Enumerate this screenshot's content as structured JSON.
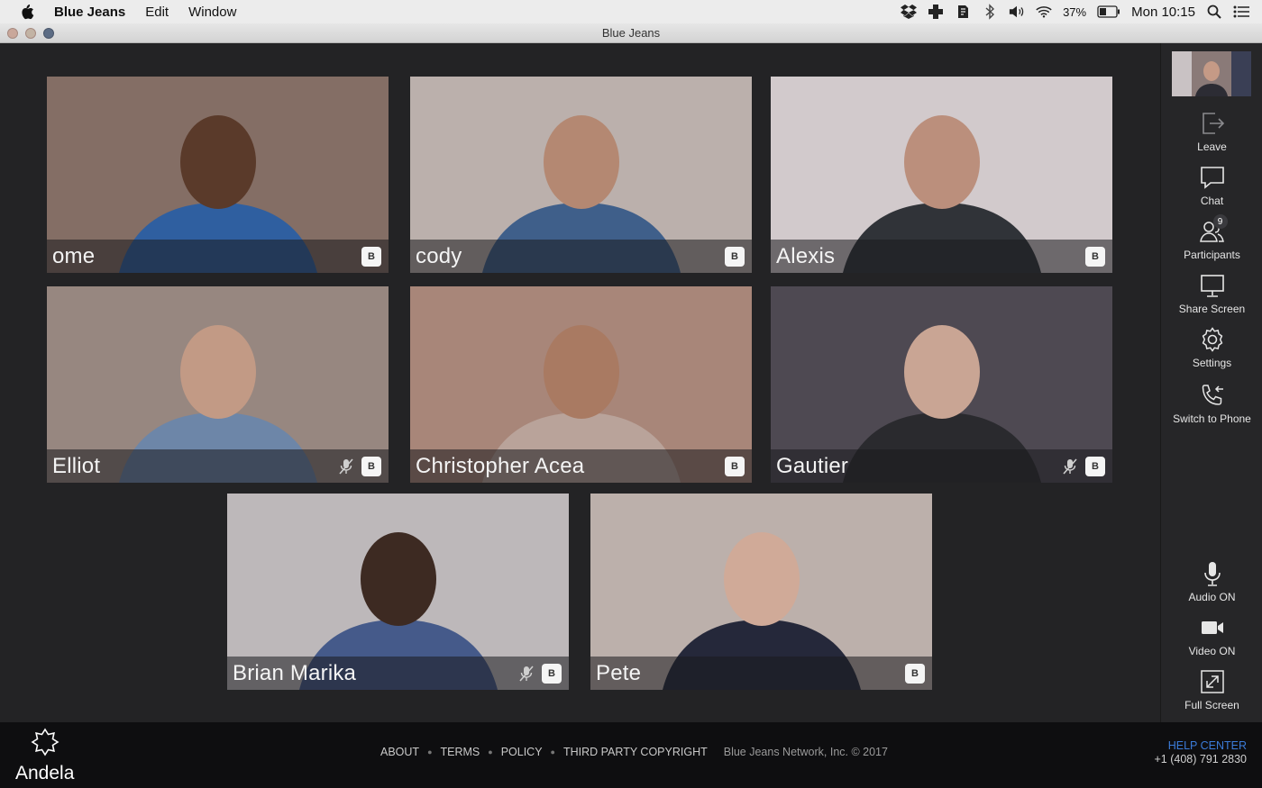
{
  "menubar": {
    "app_name": "Blue Jeans",
    "menus": [
      "Edit",
      "Window"
    ],
    "battery_percent": "37%",
    "clock": "Mon 10:15",
    "tray_icons": [
      "dropbox-icon",
      "plus-app-icon",
      "evernote-icon",
      "bluetooth-icon",
      "volume-icon",
      "wifi-icon",
      "battery-icon",
      "spotlight-search-icon",
      "notification-center-icon"
    ]
  },
  "window": {
    "title": "Blue Jeans"
  },
  "participants": [
    {
      "name": "ome",
      "muted": false,
      "bg": "#7a6258",
      "shirt": "#2f5fa0",
      "skin": "#5a3a2a"
    },
    {
      "name": "cody",
      "muted": false,
      "bg": "#b6aaa5",
      "shirt": "#3f5f8a",
      "skin": "#b48872"
    },
    {
      "name": "Alexis",
      "muted": false,
      "bg": "#cfc6c8",
      "shirt": "#303338",
      "skin": "#bb8f7c"
    },
    {
      "name": "Elliot",
      "muted": true,
      "bg": "#8f7d76",
      "shirt": "#6d86a8",
      "skin": "#c29a85"
    },
    {
      "name": "Christopher Acea",
      "muted": false,
      "bg": "#a17c6e",
      "shirt": "#b9a39a",
      "skin": "#a97a62"
    },
    {
      "name": "Gautier",
      "muted": true,
      "bg": "#3f3a44",
      "shirt": "#2a2a2e",
      "skin": "#c9a594"
    },
    {
      "name": "Brian Marika",
      "muted": true,
      "bg": "#b8b2b5",
      "shirt": "#455a8a",
      "skin": "#3d2a22"
    },
    {
      "name": "Pete",
      "muted": false,
      "bg": "#b7aaa4",
      "shirt": "#25283a",
      "skin": "#d0aa98"
    }
  ],
  "participant_badge": "B",
  "sidebar": {
    "leave": "Leave",
    "chat": "Chat",
    "participants": "Participants",
    "participants_count": "9",
    "share_screen": "Share Screen",
    "settings": "Settings",
    "switch_to_phone": "Switch to Phone",
    "audio": "Audio ON",
    "video": "Video ON",
    "full_screen": "Full Screen"
  },
  "footer": {
    "brand": "Andela",
    "links": [
      "ABOUT",
      "TERMS",
      "POLICY",
      "THIRD PARTY COPYRIGHT"
    ],
    "copyright": "Blue Jeans Network, Inc. © 2017",
    "help_center": "HELP CENTER",
    "phone": "+1 (408) 791 2830"
  }
}
